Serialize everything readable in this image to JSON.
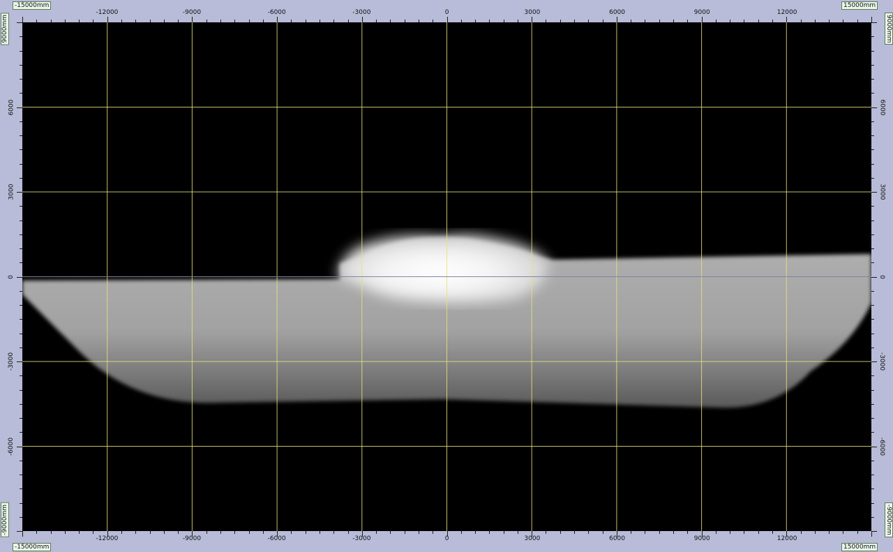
{
  "view": {
    "unit": "mm",
    "x_range": [
      -15000,
      15000
    ],
    "y_range": [
      -9000,
      9000
    ],
    "grid_step": 3000,
    "grid_color": "#e8e27a",
    "background": "#000000",
    "ruler_color": "#b8bcd8"
  },
  "corner_labels": {
    "top_left": "-15000mm",
    "top_right": "15000mm",
    "bottom_left": "-15000mm",
    "bottom_right": "15000mm",
    "left_top": "9000mm",
    "left_bottom": "-9000mm",
    "right_top": "9000mm",
    "right_bottom": "-9000mm"
  },
  "x_ticks": [
    "-12000",
    "-9000",
    "-6000",
    "-3000",
    "0",
    "3000",
    "6000",
    "9000",
    "12000"
  ],
  "x_tick_values": [
    -12000,
    -9000,
    -6000,
    -3000,
    0,
    3000,
    6000,
    9000,
    12000
  ],
  "y_ticks": [
    "6000",
    "3000",
    "0",
    "-3000",
    "-6000"
  ],
  "y_tick_values": [
    6000,
    3000,
    0,
    -3000,
    -6000
  ],
  "object": {
    "name": "vehicle side profile (grayscale depth render)",
    "body_color": "#a9a9a9",
    "cabin_color": "#ffffff"
  }
}
